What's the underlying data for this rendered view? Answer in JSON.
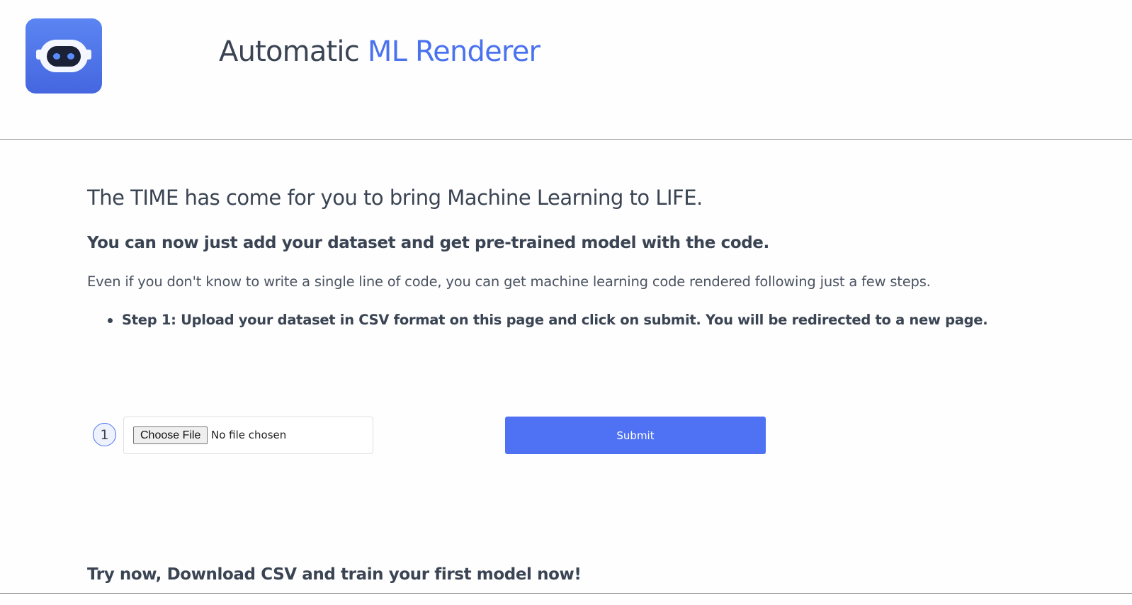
{
  "header": {
    "logo_icon": "robot-face-icon",
    "title_plain": "Automatic",
    "title_accent": "ML Renderer",
    "accent_color": "#4a72ef",
    "logo_color": "#4f72f0"
  },
  "main": {
    "heading": "The TIME has come for you to bring Machine Learning to LIFE.",
    "subheading": "You can now just add your dataset and get pre-trained model with the code.",
    "intro": "Even if you don't know to write a single line of code, you can get machine learning code rendered following just a few steps.",
    "steps": [
      {
        "label": "Step 1: Upload your dataset in CSV format on this page and click on submit. You will be redirected to a new page."
      }
    ]
  },
  "upload_form": {
    "step_number": "1",
    "choose_file_label": "Choose File",
    "file_status": "No file chosen",
    "submit_label": "Submit",
    "submit_color": "#4f72f4"
  },
  "footer_cta": {
    "text": "Try now, Download CSV and train your first model now!"
  }
}
